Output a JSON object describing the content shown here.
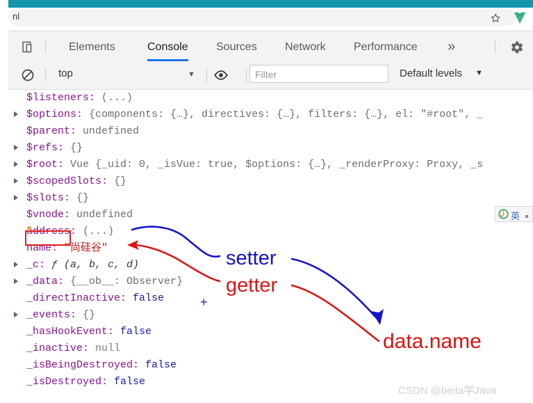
{
  "browser": {
    "omnibox_text": "nl",
    "star_icon": "star-icon",
    "extension_icon": "vue-devtools-icon"
  },
  "devtools": {
    "device_toolbar_icon": "device-toolbar-icon",
    "tabs": [
      {
        "label": "Elements",
        "active": false
      },
      {
        "label": "Console",
        "active": true
      },
      {
        "label": "Sources",
        "active": false
      },
      {
        "label": "Network",
        "active": false
      },
      {
        "label": "Performance",
        "active": false
      }
    ],
    "more_tabs": "»",
    "settings_icon": "gear-icon"
  },
  "console_toolbar": {
    "clear_icon": "clear-console-icon",
    "context": "top",
    "context_caret": "▼",
    "eye_icon": "eye-icon",
    "filter_placeholder": "Filter",
    "filter_value": "",
    "levels": "Default levels",
    "levels_caret": "▼"
  },
  "console_output": {
    "lines": [
      {
        "expandable": false,
        "key": "$listeners",
        "key_class": "k-prop",
        "value": "(...)",
        "value_class": "v-plain"
      },
      {
        "expandable": true,
        "key": "$options",
        "key_class": "k-prop",
        "value": "{components: {…}, directives: {…}, filters: {…}, el: \"#root\", _",
        "value_class": "v-plain",
        "has_string": true
      },
      {
        "expandable": false,
        "key": "$parent",
        "key_class": "k-prop",
        "value": "undefined",
        "value_class": "v-plain"
      },
      {
        "expandable": true,
        "key": "$refs",
        "key_class": "k-prop",
        "value": "{}",
        "value_class": "v-plain"
      },
      {
        "expandable": true,
        "key": "$root",
        "key_class": "k-prop",
        "value": "Vue {_uid: 0, _isVue: true, $options: {…}, _renderProxy: Proxy, _s",
        "value_class": "v-plain",
        "has_num": true
      },
      {
        "expandable": true,
        "key": "$scopedSlots",
        "key_class": "k-prop",
        "value": "{}",
        "value_class": "v-plain"
      },
      {
        "expandable": true,
        "key": "$slots",
        "key_class": "k-prop",
        "value": "{}",
        "value_class": "v-plain"
      },
      {
        "expandable": false,
        "key": "$vnode",
        "key_class": "k-prop",
        "value": "undefined",
        "value_class": "v-plain"
      },
      {
        "expandable": false,
        "key": "address",
        "key_class": "k-prop",
        "value": "(...)",
        "value_class": "v-plain"
      },
      {
        "expandable": false,
        "key": "name",
        "key_class": "k-prop",
        "value": "\"尚硅谷\"",
        "value_class": "v-str",
        "highlighted": true
      },
      {
        "expandable": true,
        "key": "_c",
        "key_class": "k-prop",
        "value": "ƒ (a, b, c, d)",
        "value_class": "v-fn"
      },
      {
        "expandable": true,
        "key": "_data",
        "key_class": "k-prop",
        "value": "{__ob__: Observer}",
        "value_class": "v-plain"
      },
      {
        "expandable": false,
        "key": "_directInactive",
        "key_class": "k-prop",
        "value": "false",
        "value_class": "v-bool"
      },
      {
        "expandable": true,
        "key": "_events",
        "key_class": "k-prop",
        "value": "{}",
        "value_class": "v-plain"
      },
      {
        "expandable": false,
        "key": "_hasHookEvent",
        "key_class": "k-prop",
        "value": "false",
        "value_class": "v-bool"
      },
      {
        "expandable": false,
        "key": "_inactive",
        "key_class": "k-prop",
        "value": "null",
        "value_class": "v-null"
      },
      {
        "expandable": false,
        "key": "_isBeingDestroyed",
        "key_class": "k-prop",
        "value": "false",
        "value_class": "v-bool"
      },
      {
        "expandable": false,
        "key": "_isDestroyed",
        "key_class": "k-prop",
        "value": "false",
        "value_class": "v-bool"
      }
    ]
  },
  "annotations": {
    "setter_label": "setter",
    "getter_label": "getter",
    "data_name_label": "data.name",
    "plus_mark": "+",
    "setter_color": "#1414c8",
    "getter_color": "#dc1414",
    "box_color": "#e02020"
  },
  "ime": {
    "mode": "英",
    "logo": "sogou-ime-icon"
  },
  "watermark": {
    "text": "CSDN @beita学Java"
  }
}
